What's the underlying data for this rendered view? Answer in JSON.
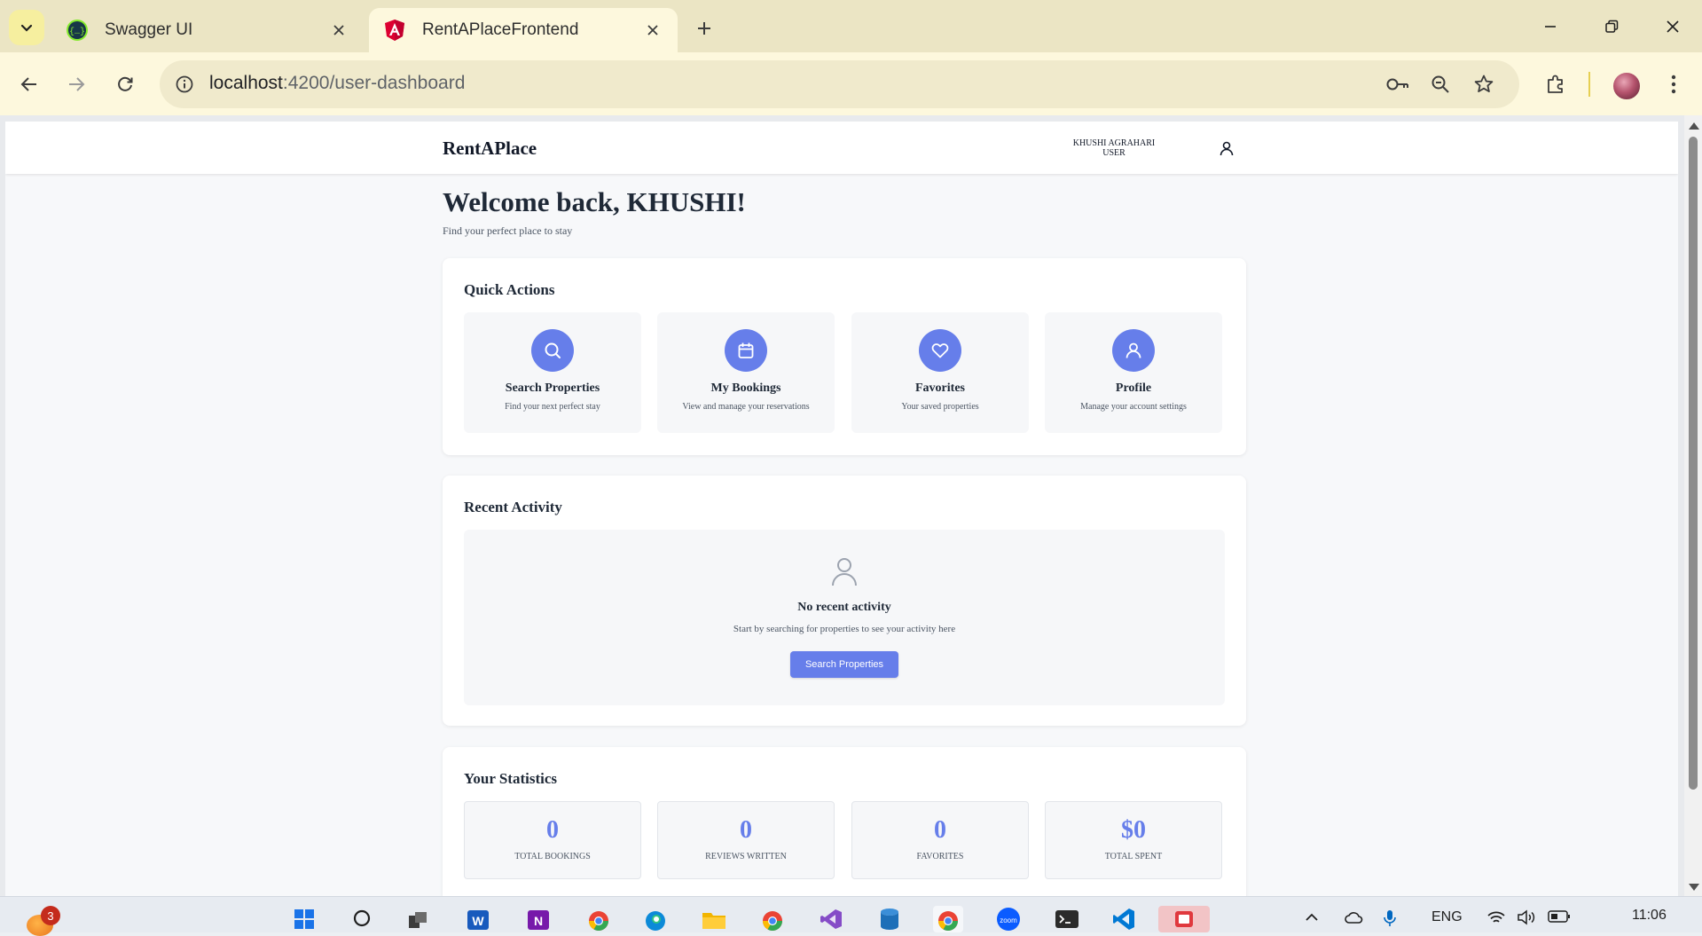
{
  "browser": {
    "tabs": [
      {
        "title": "Swagger UI",
        "active": false
      },
      {
        "title": "RentAPlaceFrontend",
        "active": true
      }
    ],
    "url": {
      "host": "localhost",
      "path": ":4200/user-dashboard"
    }
  },
  "app": {
    "brand": "RentAPlace",
    "user_name": "KHUSHI AGRAHARI",
    "user_role": "USER"
  },
  "welcome": {
    "title": "Welcome back, KHUSHI!",
    "subtitle": "Find your perfect place to stay"
  },
  "quick_actions": {
    "title": "Quick Actions",
    "items": [
      {
        "icon": "search-icon",
        "label": "Search Properties",
        "desc": "Find your next perfect stay"
      },
      {
        "icon": "calendar-icon",
        "label": "My Bookings",
        "desc": "View and manage your reservations"
      },
      {
        "icon": "heart-icon",
        "label": "Favorites",
        "desc": "Your saved properties"
      },
      {
        "icon": "user-icon",
        "label": "Profile",
        "desc": "Manage your account settings"
      }
    ]
  },
  "recent_activity": {
    "title": "Recent Activity",
    "empty_title": "No recent activity",
    "empty_sub": "Start by searching for properties to see your activity here",
    "button_label": "Search Properties"
  },
  "statistics": {
    "title": "Your Statistics",
    "items": [
      {
        "value": "0",
        "label": "TOTAL BOOKINGS"
      },
      {
        "value": "0",
        "label": "REVIEWS WRITTEN"
      },
      {
        "value": "0",
        "label": "FAVORITES"
      },
      {
        "value": "$0",
        "label": "TOTAL SPENT"
      }
    ]
  },
  "taskbar": {
    "notification_count": "3",
    "language": "ENG",
    "time": "11:06"
  },
  "colors": {
    "accent": "#667eea",
    "tabbar": "#ebe5c4",
    "toolbar": "#fdf8dd"
  }
}
